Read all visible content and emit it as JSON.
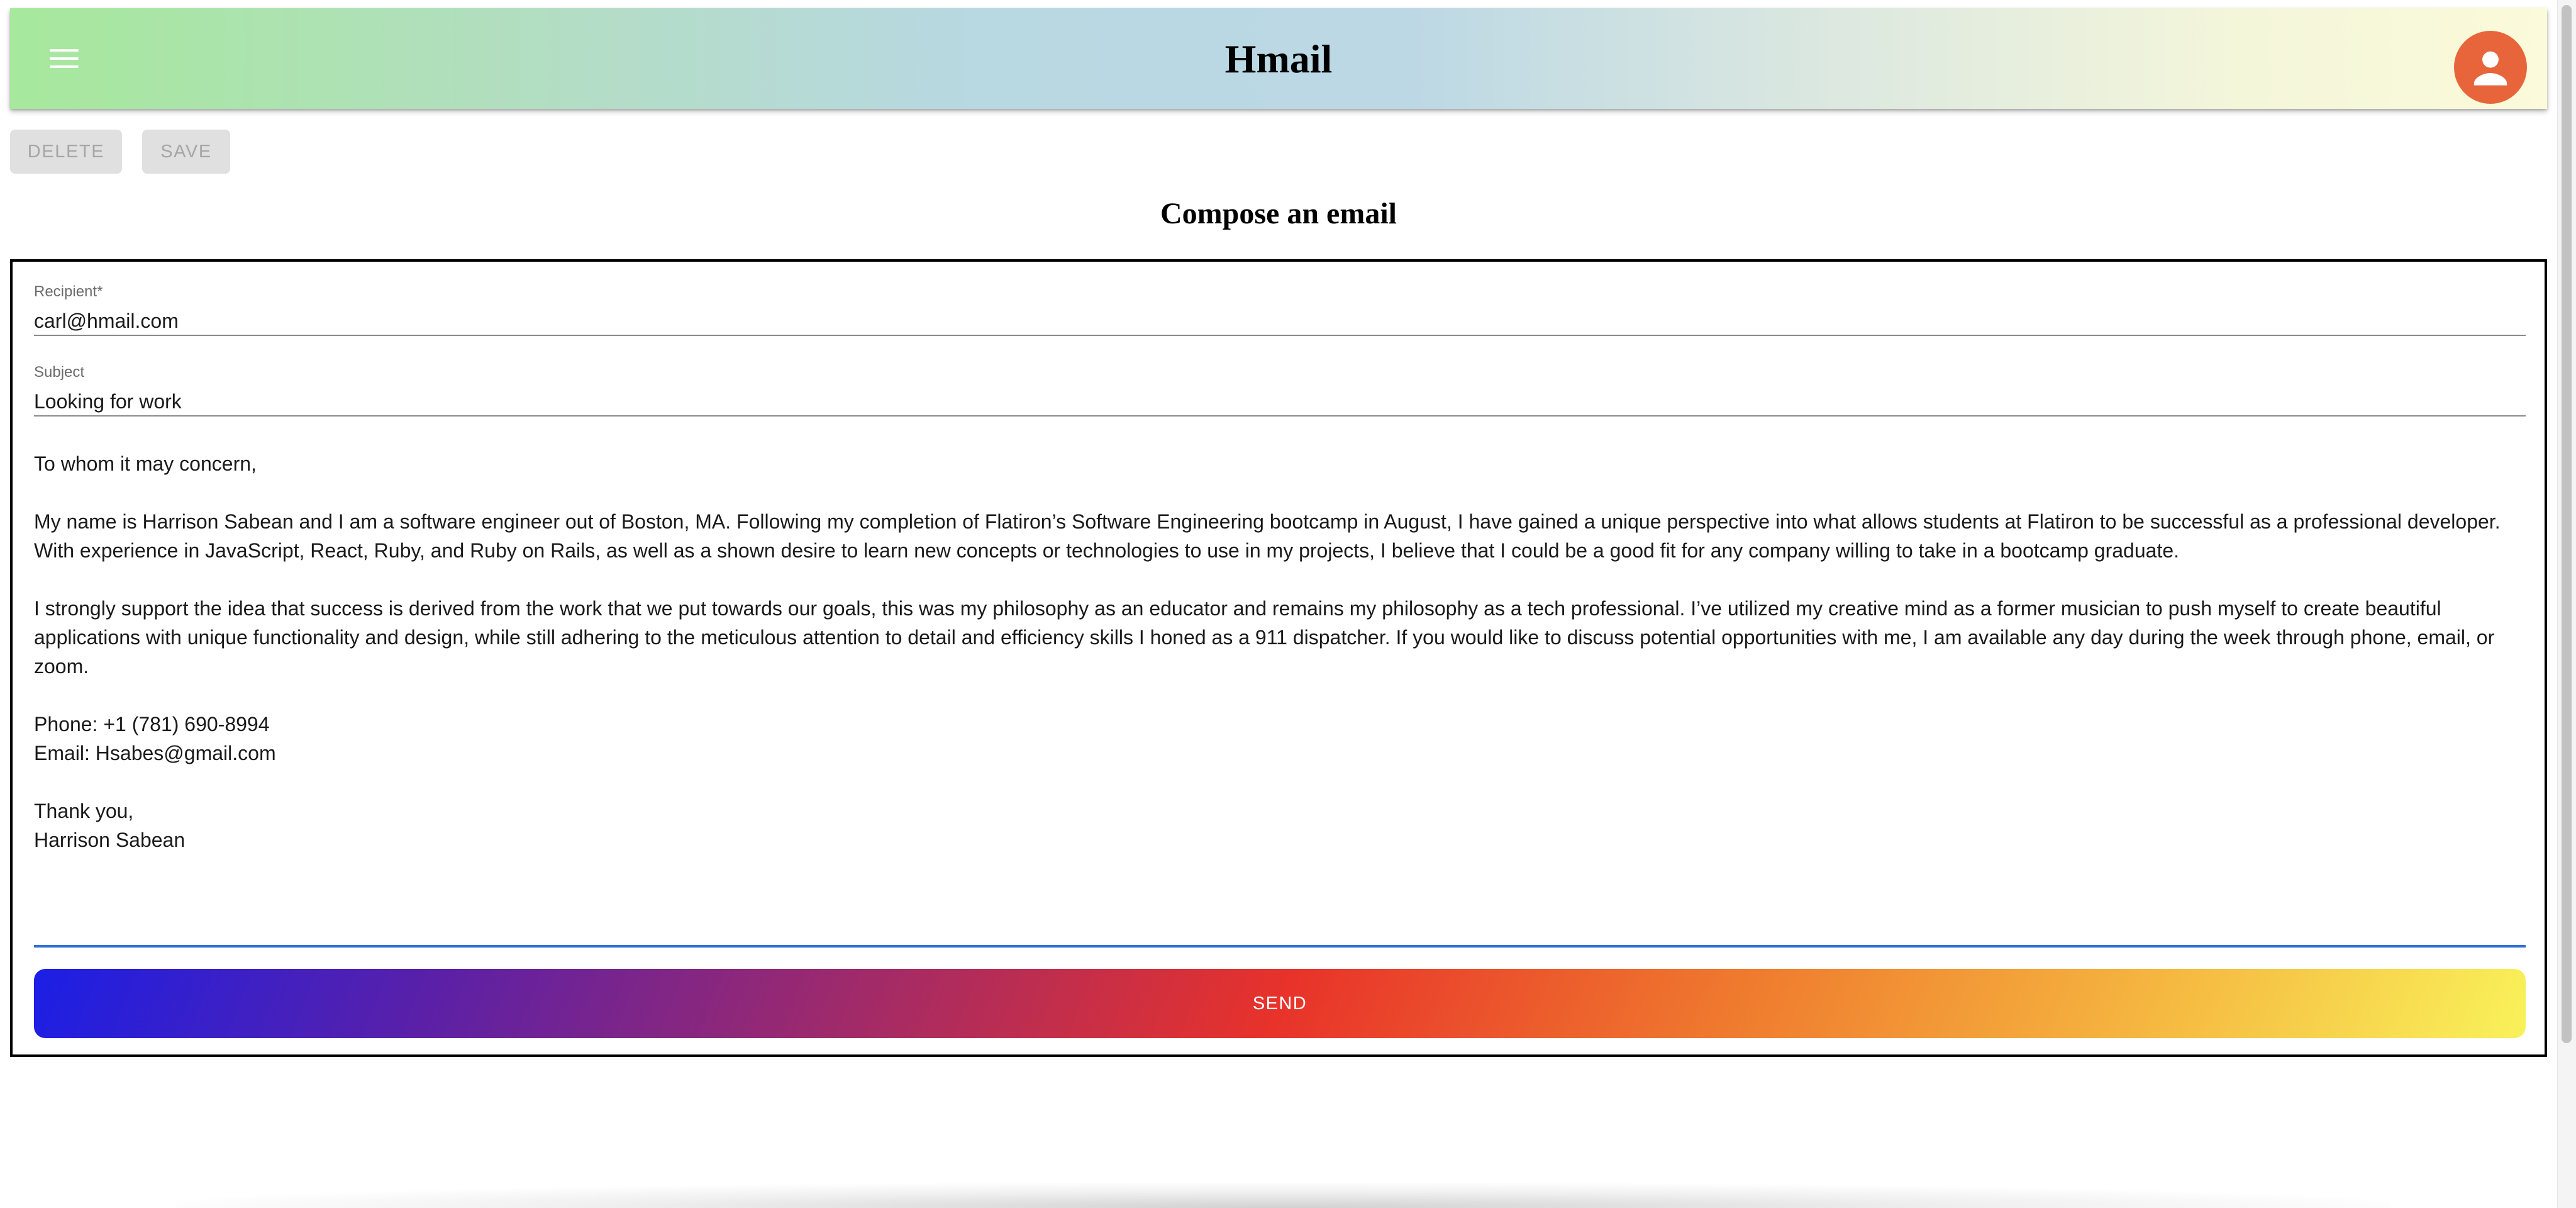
{
  "app": {
    "title": "Hmail",
    "brand_gradient": [
      "#a6e89c",
      "#bcd8e4",
      "#fbfada"
    ],
    "avatar_color": "#e8653c"
  },
  "toolbar": {
    "delete_label": "DELETE",
    "save_label": "SAVE"
  },
  "page": {
    "heading": "Compose an email"
  },
  "form": {
    "recipient": {
      "label": "Recipient",
      "required_mark": "*",
      "value": "carl@hmail.com"
    },
    "subject": {
      "label": "Subject",
      "value": "Looking for work"
    },
    "body": "To whom it may concern,\n\nMy name is Harrison Sabean and I am a software engineer out of Boston, MA. Following my completion of Flatiron’s Software Engineering bootcamp in August, I have gained a unique perspective into what allows students at Flatiron to be successful as a professional developer. With experience in JavaScript, React, Ruby, and Ruby on Rails, as well as a shown desire to learn new concepts or technologies to use in my projects, I believe that I could be a good fit for any company willing to take in a bootcamp graduate.\n\nI strongly support the idea that success is derived from the work that we put towards our goals, this was my philosophy as an educator and remains my philosophy as a tech professional. I’ve utilized my creative mind as a former musician to push myself to create beautiful applications with unique functionality and design, while still adhering to the meticulous attention to detail and efficiency skills I honed as a 911 dispatcher. If you would like to discuss potential opportunities with me, I am available any day during the week through phone, email, or zoom.\n\nPhone: +1 (781) 690-8994\nEmail: Hsabes@gmail.com\n\nThank you,\nHarrison Sabean",
    "focus_color": "#2f6fd8",
    "send_label": "SEND",
    "send_gradient": [
      "#1b1fe6",
      "#e8322a",
      "#f9f25a"
    ]
  },
  "icons": {
    "menu": "menu-icon",
    "avatar": "account-circle-icon"
  }
}
